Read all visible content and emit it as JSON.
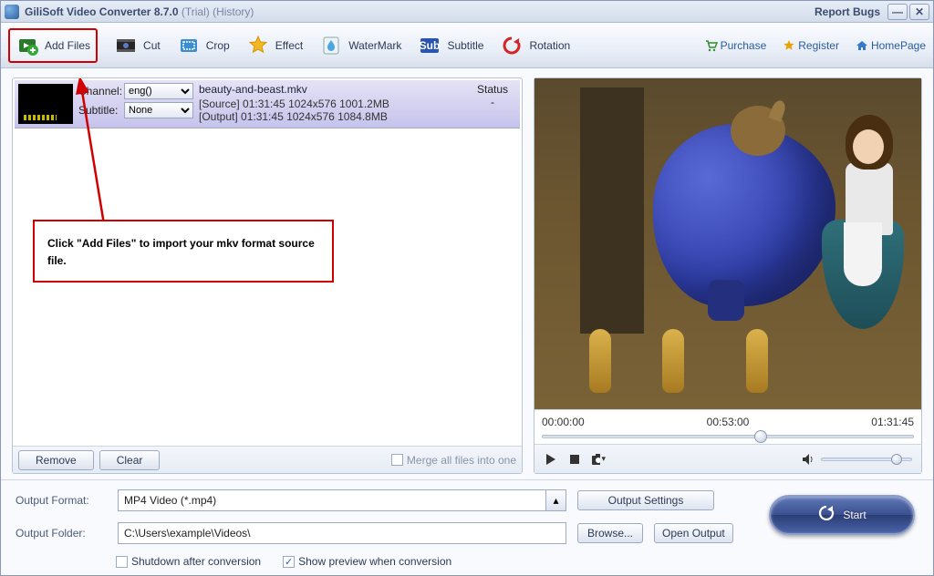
{
  "window": {
    "app_name": "GiliSoft Video Converter",
    "version": "8.7.0",
    "edition": "(Trial)",
    "history": "(History)",
    "report_bugs": "Report Bugs"
  },
  "toolbar": {
    "add_files": "Add Files",
    "cut": "Cut",
    "crop": "Crop",
    "effect": "Effect",
    "watermark": "WaterMark",
    "subtitle": "Subtitle",
    "rotation": "Rotation",
    "purchase": "Purchase",
    "register": "Register",
    "homepage": "HomePage"
  },
  "file": {
    "channel_label": "Channel:",
    "channel_value": "eng()",
    "subtitle_label": "Subtitle:",
    "subtitle_value": "None",
    "filename": "beauty-and-beast.mkv",
    "status_header": "Status",
    "status_value": "-",
    "source_line": "[Source]  01:31:45  1024x576  1001.2MB",
    "output_line": "[Output]  01:31:45  1024x576  1084.8MB"
  },
  "annotation": {
    "text": "Click \"Add Files\" to import your mkv format source file."
  },
  "leftfoot": {
    "remove": "Remove",
    "clear": "Clear",
    "merge": "Merge all files into one"
  },
  "player": {
    "t_start": "00:00:00",
    "t_mid": "00:53:00",
    "t_end": "01:31:45"
  },
  "output": {
    "format_label": "Output Format:",
    "format_value": "MP4 Video (*.mp4)",
    "folder_label": "Output Folder:",
    "folder_value": "C:\\Users\\example\\Videos\\",
    "output_settings": "Output Settings",
    "browse": "Browse...",
    "open_output": "Open Output",
    "shutdown": "Shutdown after conversion",
    "preview": "Show preview when conversion",
    "start": "Start"
  }
}
